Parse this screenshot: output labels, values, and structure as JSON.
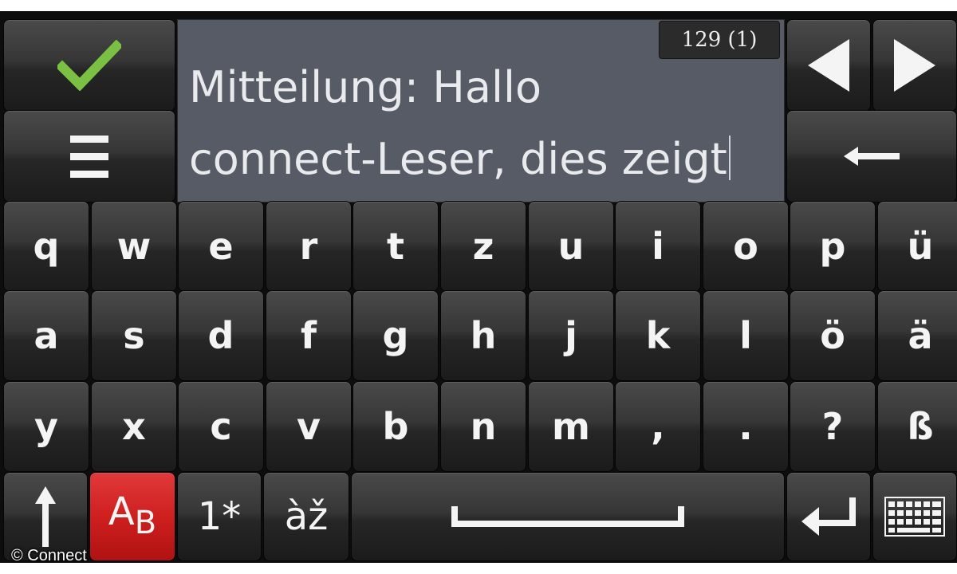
{
  "text_field": {
    "line1": "Mitteilung: Hallo",
    "line2": "connect-Leser, dies zeigt",
    "counter": "129 (1)"
  },
  "top_controls": {
    "confirm_icon": "checkmark-icon",
    "menu_icon": "menu-icon",
    "left_icon": "arrow-left-icon",
    "right_icon": "arrow-right-icon",
    "backspace_icon": "backspace-icon"
  },
  "keyboard": {
    "row1": [
      "q",
      "w",
      "e",
      "r",
      "t",
      "z",
      "u",
      "i",
      "o",
      "p",
      "ü"
    ],
    "row2": [
      "a",
      "s",
      "d",
      "f",
      "g",
      "h",
      "j",
      "k",
      "l",
      "ö",
      "ä"
    ],
    "row3": [
      "y",
      "x",
      "c",
      "v",
      "b",
      "n",
      "m",
      ",",
      ".",
      "?",
      "ß"
    ],
    "bottom": {
      "shift_icon": "shift-arrow-icon",
      "case_label_a": "A",
      "case_label_b": "B",
      "numbers_label": "1*",
      "accents_label": "àž",
      "space_icon": "space-bar-icon",
      "enter_icon": "enter-icon",
      "layout_icon": "keyboard-icon"
    }
  },
  "colors": {
    "accent_red": "#cf1f1f",
    "check_green": "#7ac143",
    "text_field_bg": "#575b66"
  },
  "watermark": "© Connect"
}
